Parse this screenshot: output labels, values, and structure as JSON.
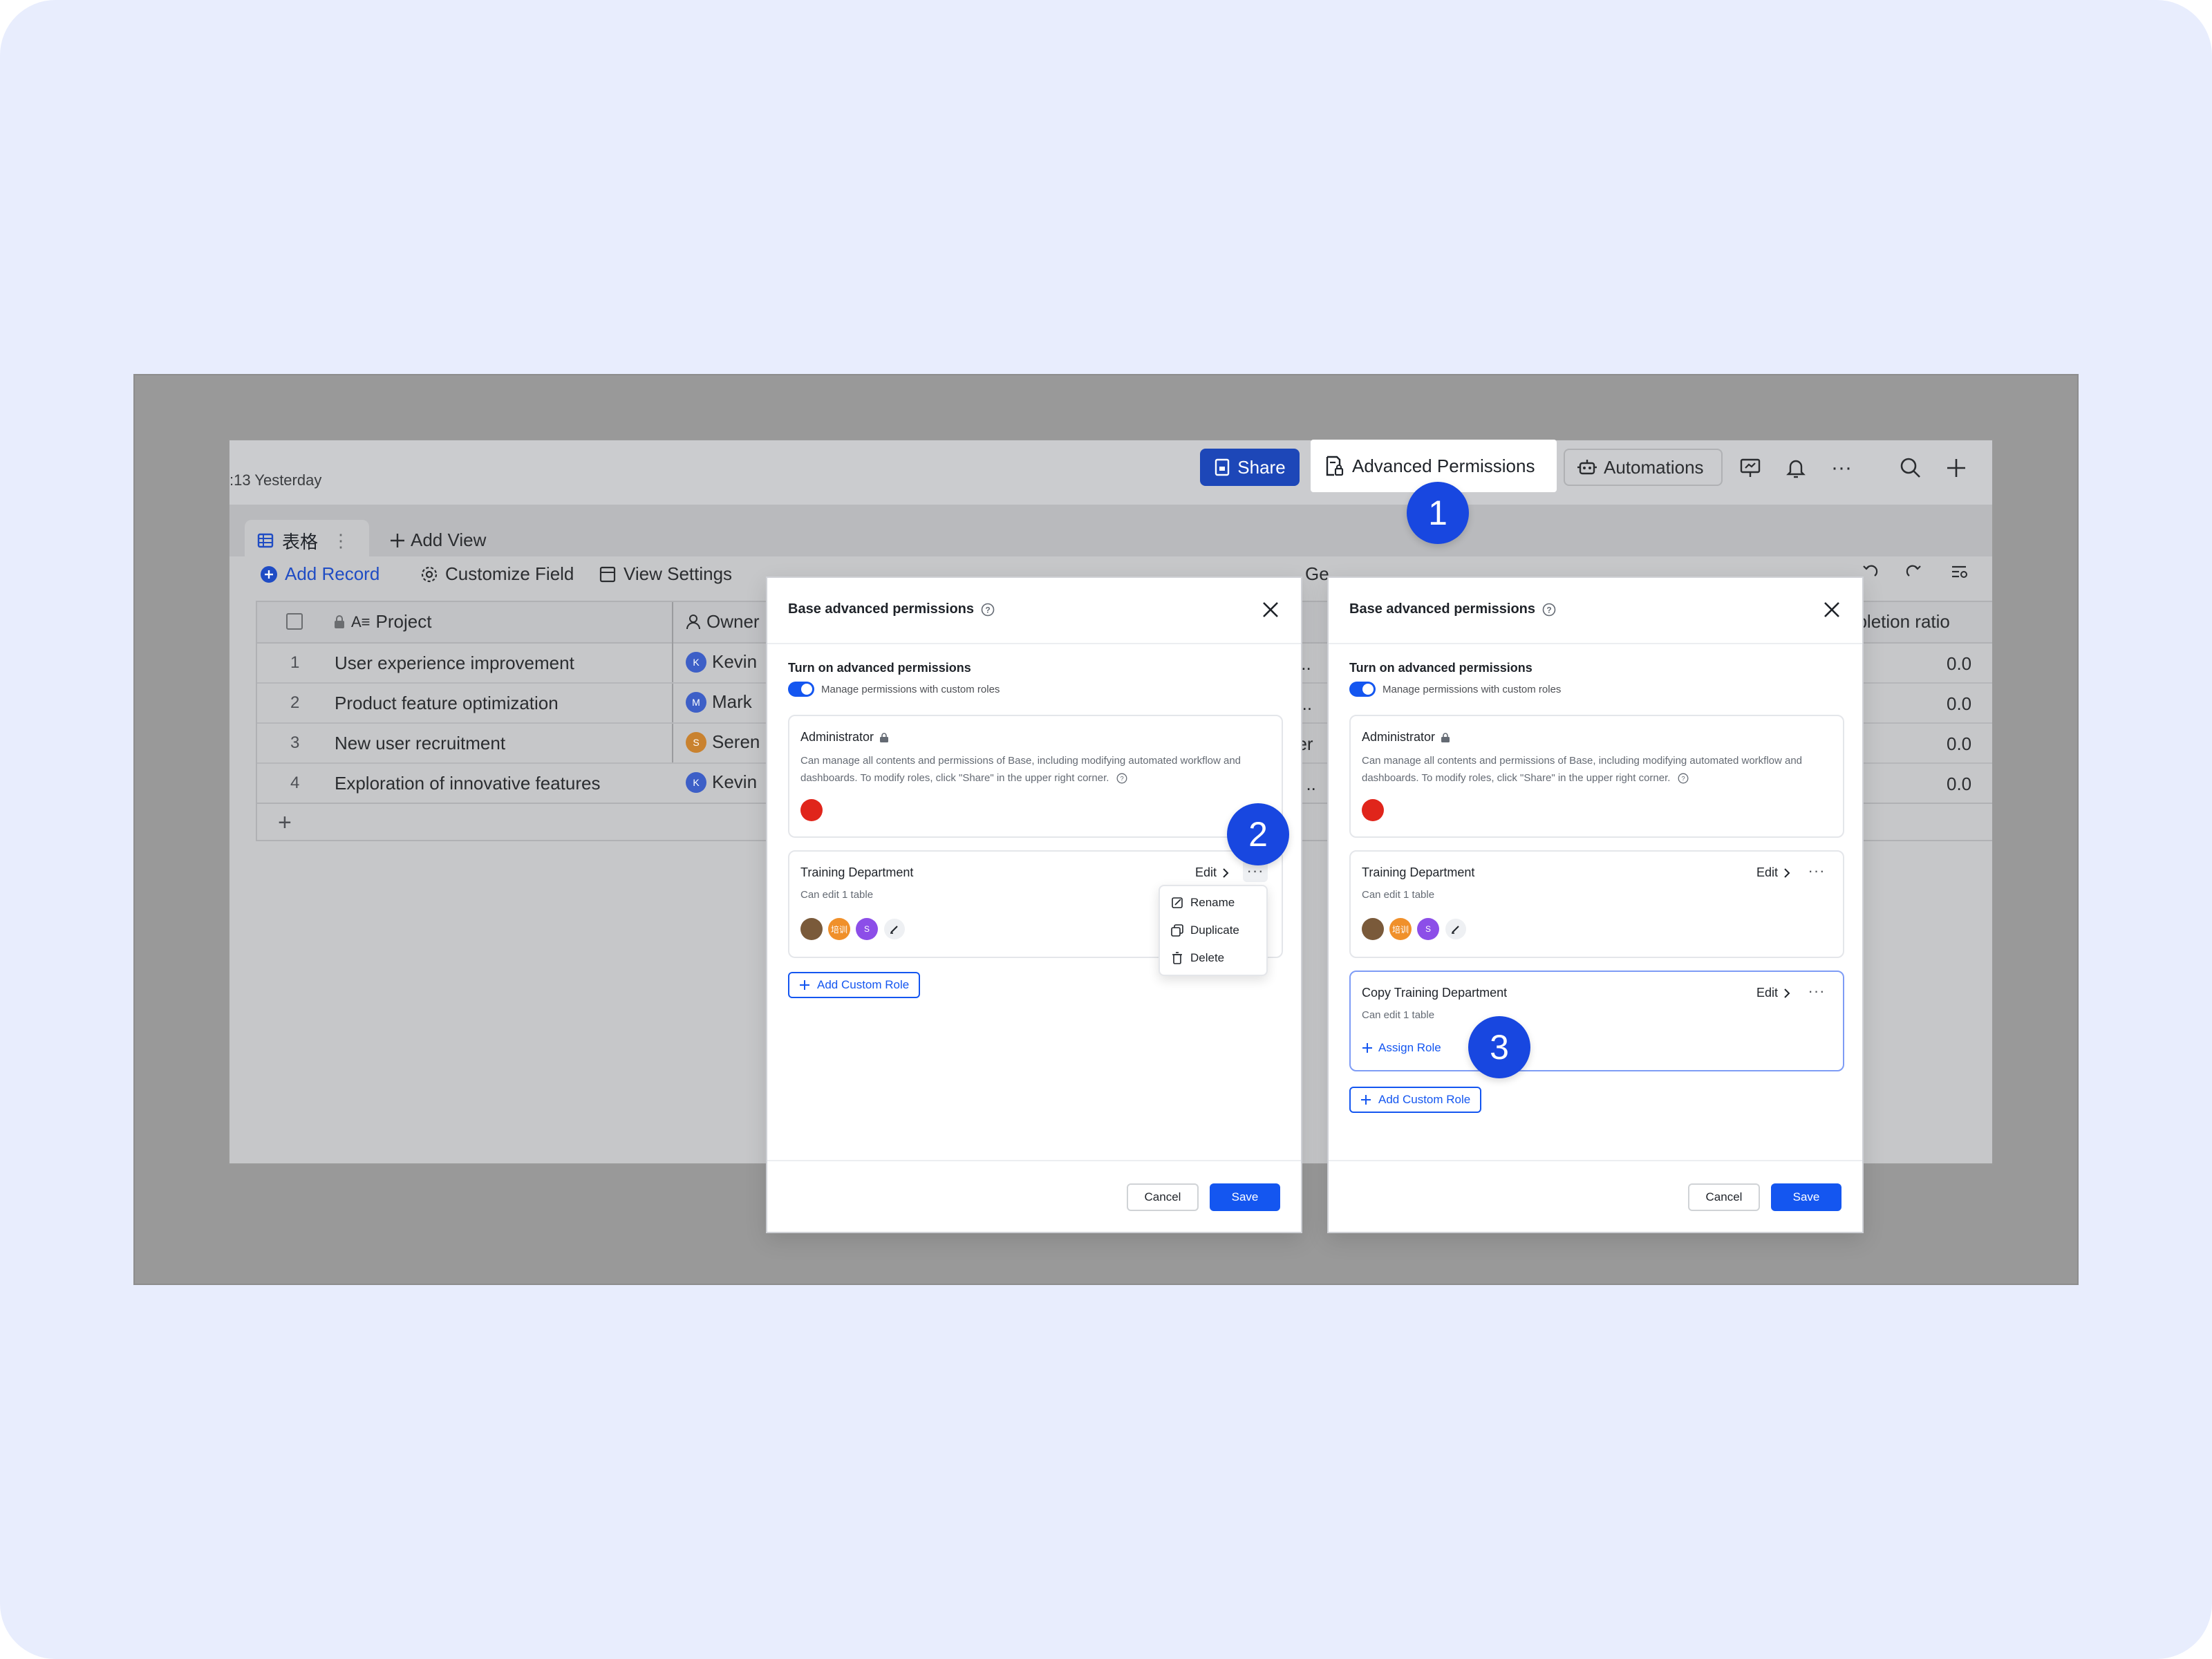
{
  "app": {
    "timestamp": ":13 Yesterday",
    "header": {
      "share_label": "Share",
      "advanced_permissions_label": "Advanced Permissions",
      "automations_label": "Automations"
    },
    "tabs": [
      {
        "label": "表格"
      }
    ],
    "add_view_label": "Add View",
    "toolbar": {
      "add_record": "Add Record",
      "customize_field": "Customize Field",
      "view_settings": "View Settings",
      "peek_text": "Ge"
    },
    "table": {
      "columns": [
        "Project",
        "Owner",
        "npletion ratio"
      ],
      "rows": [
        {
          "n": "1",
          "project": "User experience improvement",
          "owner": "Kevin",
          "owner_initial": "K",
          "status_peek": "io..",
          "ratio": "0.0"
        },
        {
          "n": "2",
          "project": "Product feature optimization",
          "owner": "Mark",
          "owner_initial": "M",
          "status_peek": "et..",
          "ratio": "0.0"
        },
        {
          "n": "3",
          "project": "New user recruitment",
          "owner": "Seren",
          "owner_initial": "S",
          "status_peek": "ber",
          "ratio": "0.0"
        },
        {
          "n": "4",
          "project": "Exploration of innovative features",
          "owner": "Kevin",
          "owner_initial": "K",
          "status_peek": "al ..",
          "ratio": "0.0"
        }
      ]
    }
  },
  "badges": [
    "1",
    "2",
    "3"
  ],
  "modal": {
    "title": "Base advanced permissions",
    "section_title": "Turn on advanced permissions",
    "toggle_label": "Manage permissions with custom roles",
    "admin": {
      "title": "Administrator",
      "desc": "Can manage all contents and permissions of Base, including modifying automated workflow and dashboards. To modify roles, click \"Share\" in the upper right corner."
    },
    "training": {
      "title": "Training Department",
      "sub": "Can edit 1 table",
      "edit_label": "Edit",
      "more_label": "···",
      "avatar_labels": [
        "",
        "培训",
        "S"
      ]
    },
    "copy_training": {
      "title": "Copy Training Department",
      "sub": "Can edit 1 table",
      "edit_label": "Edit",
      "more_label": "···",
      "assign_label": "Assign Role"
    },
    "add_custom_role": "Add Custom Role",
    "cancel": "Cancel",
    "save": "Save",
    "menu": [
      "Rename",
      "Duplicate",
      "Delete"
    ]
  },
  "colors": {
    "primary": "#1456f0",
    "badge": "#1847e0",
    "share_bg": "#1d47b8",
    "canvas_bg": "#e8edfd"
  }
}
